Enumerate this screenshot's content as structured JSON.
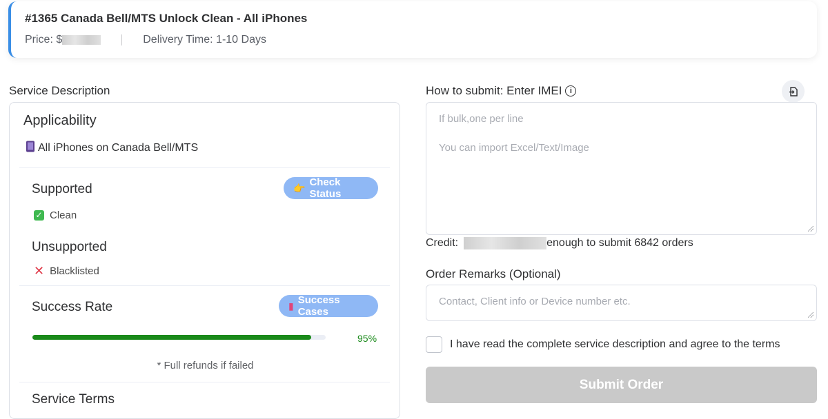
{
  "header": {
    "title": "#1365 Canada Bell/MTS Unlock Clean - All iPhones",
    "price_label": "Price: $",
    "delivery": "Delivery Time: 1-10 Days"
  },
  "description": {
    "section_label": "Service Description",
    "applicability_title": "Applicability",
    "applicability_icon": "phone-icon",
    "applicability_text": "All iPhones  on Canada Bell/MTS",
    "supported_title": "Supported",
    "check_status_icon": "pointing-hand-icon",
    "check_status_label": "Check Status",
    "supported_item": "Clean",
    "unsupported_title": "Unsupported",
    "unsupported_item": "Blacklisted",
    "success_rate_title": "Success Rate",
    "success_cases_icon": "magnet-icon",
    "success_cases_label": "Success Cases",
    "success_rate_value": 0.95,
    "success_rate_text": "95%",
    "refund_note": "* Full refunds if failed",
    "terms_title": "Service Terms"
  },
  "submit": {
    "how_label": "How to submit: Enter IMEI",
    "imei_placeholder_line1": "If bulk,one per line",
    "imei_placeholder_line2": "You can import Excel/Text/Image",
    "credit_prefix": "Credit:",
    "credit_suffix": "enough to submit 6842 orders",
    "remarks_label": "Order Remarks (Optional)",
    "remarks_placeholder": "Contact, Client info or Device number etc.",
    "agree_text": "I have read the complete service description and agree to the terms",
    "submit_label": "Submit Order"
  },
  "colors": {
    "accent": "#3a8ee6",
    "pill": "#8fb8f5",
    "progress": "#1a8a1a",
    "submit_disabled": "#c9c9c9"
  }
}
